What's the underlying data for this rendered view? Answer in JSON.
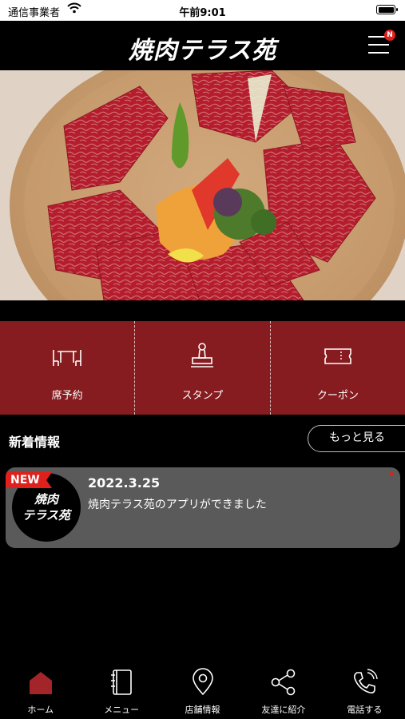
{
  "status_bar": {
    "carrier": "通信事業者",
    "time": "午前9:01"
  },
  "header": {
    "brand": "焼肉テラス苑",
    "menu_badge": "N"
  },
  "features": [
    {
      "label": "席予約",
      "icon": "table-chairs-icon"
    },
    {
      "label": "スタンプ",
      "icon": "stamp-icon"
    },
    {
      "label": "クーポン",
      "icon": "coupon-ticket-icon"
    }
  ],
  "news": {
    "title": "新着情報",
    "more_label": "もっと見る",
    "items": [
      {
        "badge": "NEW",
        "date": "2022.3.25",
        "text": "焼肉テラス苑のアプリができました",
        "logo_line1": "焼肉",
        "logo_line2": "テラス苑"
      }
    ]
  },
  "tabs": [
    {
      "label": "ホーム",
      "icon": "home-icon",
      "active": true
    },
    {
      "label": "メニュー",
      "icon": "menu-book-icon"
    },
    {
      "label": "店舗情報",
      "icon": "map-pin-icon"
    },
    {
      "label": "友達に紹介",
      "icon": "share-icon"
    },
    {
      "label": "電話する",
      "icon": "phone-icon"
    }
  ],
  "colors": {
    "brand_red": "#861c1f",
    "badge_red": "#e0201c",
    "tab_active": "#a3252a"
  }
}
